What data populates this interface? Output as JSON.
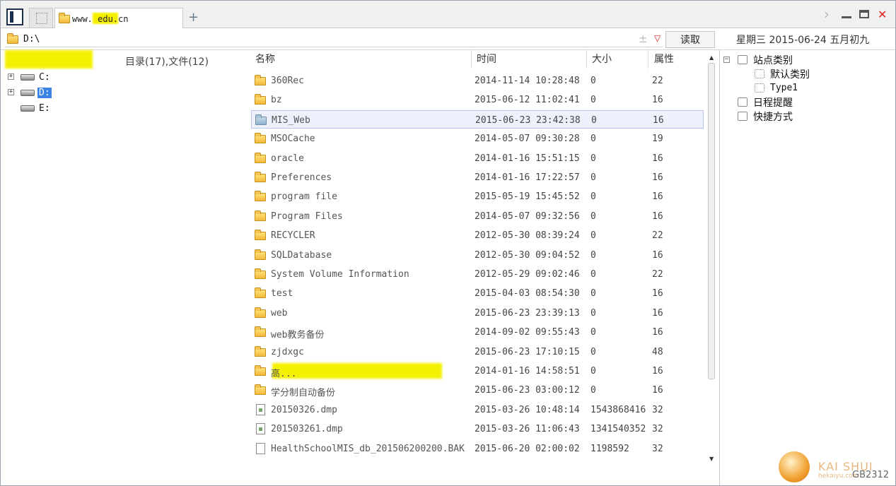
{
  "tabbar": {
    "tab_title": "www.      edu.cn",
    "new_tab": "+",
    "nav_forward": "›",
    "close": "✕"
  },
  "address": {
    "path": "D:\\",
    "plus_minus": "±",
    "dropdown": "▽",
    "read_label": "读取",
    "date": "星期三 2015-06-24 五月初九"
  },
  "left": {
    "count": "目录(17),文件(12)",
    "drives": [
      {
        "label": "C:",
        "expand": "+",
        "selected": false
      },
      {
        "label": "D:",
        "expand": "+",
        "selected": true
      },
      {
        "label": "E:",
        "expand": "",
        "selected": false
      }
    ]
  },
  "columns": {
    "name": "名称",
    "time": "时间",
    "size": "大小",
    "attr": "属性"
  },
  "files": [
    {
      "name": "360Rec",
      "time": "2014-11-14 10:28:48",
      "size": "0",
      "attr": "22",
      "type": "folder"
    },
    {
      "name": "bz",
      "time": "2015-06-12 11:02:41",
      "size": "0",
      "attr": "16",
      "type": "folder"
    },
    {
      "name": "MIS_Web",
      "time": "2015-06-23 23:42:38",
      "size": "0",
      "attr": "16",
      "type": "folder",
      "selected": true
    },
    {
      "name": "MSOCache",
      "time": "2014-05-07 09:30:28",
      "size": "0",
      "attr": "19",
      "type": "folder"
    },
    {
      "name": "oracle",
      "time": "2014-01-16 15:51:15",
      "size": "0",
      "attr": "16",
      "type": "folder"
    },
    {
      "name": "Preferences",
      "time": "2014-01-16 17:22:57",
      "size": "0",
      "attr": "16",
      "type": "folder"
    },
    {
      "name": "program file",
      "time": "2015-05-19 15:45:52",
      "size": "0",
      "attr": "16",
      "type": "folder"
    },
    {
      "name": "Program Files",
      "time": "2014-05-07 09:32:56",
      "size": "0",
      "attr": "16",
      "type": "folder"
    },
    {
      "name": "RECYCLER",
      "time": "2012-05-30 08:39:24",
      "size": "0",
      "attr": "22",
      "type": "folder"
    },
    {
      "name": "SQLDatabase",
      "time": "2012-05-30 09:04:52",
      "size": "0",
      "attr": "16",
      "type": "folder"
    },
    {
      "name": "System Volume Information",
      "time": "2012-05-29 09:02:46",
      "size": "0",
      "attr": "22",
      "type": "folder"
    },
    {
      "name": "test",
      "time": "2015-04-03 08:54:30",
      "size": "0",
      "attr": "16",
      "type": "folder"
    },
    {
      "name": "web",
      "time": "2015-06-23 23:39:13",
      "size": "0",
      "attr": "16",
      "type": "folder"
    },
    {
      "name": "web教务备份",
      "time": "2014-09-02 09:55:43",
      "size": "0",
      "attr": "16",
      "type": "folder"
    },
    {
      "name": "zjdxgc",
      "time": "2015-06-23 17:10:15",
      "size": "0",
      "attr": "48",
      "type": "folder"
    },
    {
      "name": "                          高...",
      "time": "2014-01-16 14:58:51",
      "size": "0",
      "attr": "16",
      "type": "folder",
      "redacted": true
    },
    {
      "name": "学分制自动备份",
      "time": "2015-06-23 03:00:12",
      "size": "0",
      "attr": "16",
      "type": "folder"
    },
    {
      "name": "20150326.dmp",
      "time": "2015-03-26 10:48:14",
      "size": "1543868416",
      "attr": "32",
      "type": "dmp"
    },
    {
      "name": "201503261.dmp",
      "time": "2015-03-26 11:06:43",
      "size": "1341540352",
      "attr": "32",
      "type": "dmp"
    },
    {
      "name": "HealthSchoolMIS_db_201506200200.BAK",
      "time": "2015-06-20 02:00:02",
      "size": "1198592",
      "attr": "32",
      "type": "file"
    }
  ],
  "scroll": {
    "up": "▲",
    "down": "▼"
  },
  "right_tree": {
    "root": {
      "label": "站点类别",
      "expand": "⊟"
    },
    "children": [
      "默认类别",
      "Type1"
    ],
    "reminder": "日程提醒",
    "shortcut": "快捷方式"
  },
  "watermark": {
    "brand": "KAI SHUI",
    "sub": "hekaiyu.com"
  },
  "encoding": "GB2312",
  "icons": {
    "folder": "folder-icon",
    "file": "file-icon",
    "drive": "drive-icon",
    "close": "close-icon"
  }
}
